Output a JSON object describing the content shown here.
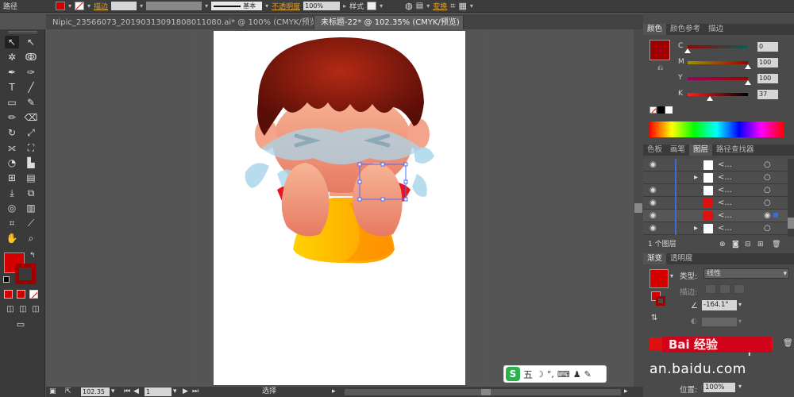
{
  "control_bar": {
    "path_label": "路径",
    "stroke_link": "描边",
    "brush_label": "基本",
    "opacity_link": "不透明度",
    "opacity_value": "100%",
    "style_label": "样式",
    "transform_link": "变换",
    "fill_color": "#d40000"
  },
  "tabs": [
    {
      "label": "Nipic_23566073_20190313091808011080.ai* @ 100% (CMYK/预览)",
      "close": "×"
    },
    {
      "label": "未标题-22* @ 102.35% (CMYK/预览)",
      "close": "×"
    }
  ],
  "color_panel": {
    "tabs": [
      "颜色",
      "颜色参考",
      "描边"
    ],
    "channels": [
      {
        "name": "C",
        "value": "0",
        "pct": 0
      },
      {
        "name": "M",
        "value": "100",
        "pct": 100
      },
      {
        "name": "Y",
        "value": "100",
        "pct": 100
      },
      {
        "name": "K",
        "value": "37",
        "pct": 37
      }
    ],
    "color": "#a00000"
  },
  "layers_panel": {
    "tabs": [
      "色板",
      "画笔",
      "图层",
      "路径查找器"
    ],
    "rows": [
      {
        "name": "<...",
        "visible": true
      },
      {
        "name": "<...",
        "visible": false
      },
      {
        "name": "<...",
        "visible": true
      },
      {
        "name": "<...",
        "visible": true
      },
      {
        "name": "<...",
        "visible": true
      },
      {
        "name": "<...",
        "visible": true
      }
    ],
    "footer": "1 个图层"
  },
  "gradient_panel": {
    "tabs": [
      "渐变",
      "透明度"
    ],
    "type_label": "类型:",
    "type_value": "线性",
    "stroke_label": "描边:",
    "angle_value": "-164.1°",
    "position_label": "位置:",
    "position_value": "100%"
  },
  "statusbar": {
    "zoom": "102.35",
    "page": "1",
    "mode": "选择"
  },
  "watermark": {
    "text": "an.baidu.com"
  },
  "ime": {
    "label": "五"
  }
}
